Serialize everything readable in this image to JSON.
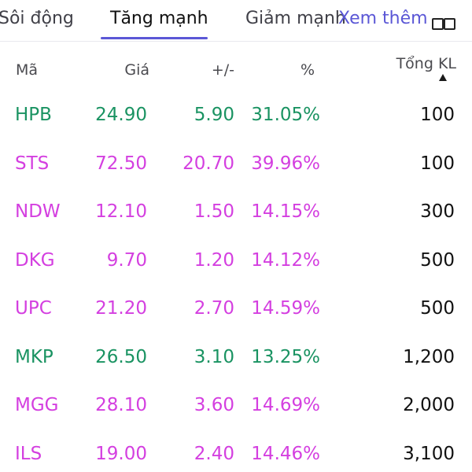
{
  "tabs": [
    {
      "label": "Sôi động"
    },
    {
      "label": "Tăng mạnh"
    },
    {
      "label": "Giảm mạnh"
    },
    {
      "label": "Xem thêm"
    }
  ],
  "header": {
    "ticker": "Mã",
    "price": "Giá",
    "change": "+/-",
    "pct": "%",
    "volume": "Tổng KL"
  },
  "colors": {
    "up": "#1a9362",
    "ceiling": "#d43fe0",
    "accent": "#5b57d6"
  },
  "rows": [
    {
      "ticker": "HPB",
      "price": "24.90",
      "change": "5.90",
      "pct": "31.05%",
      "volume": "100",
      "status": "up"
    },
    {
      "ticker": "STS",
      "price": "72.50",
      "change": "20.70",
      "pct": "39.96%",
      "volume": "100",
      "status": "ceiling"
    },
    {
      "ticker": "NDW",
      "price": "12.10",
      "change": "1.50",
      "pct": "14.15%",
      "volume": "300",
      "status": "ceiling"
    },
    {
      "ticker": "DKG",
      "price": "9.70",
      "change": "1.20",
      "pct": "14.12%",
      "volume": "500",
      "status": "ceiling"
    },
    {
      "ticker": "UPC",
      "price": "21.20",
      "change": "2.70",
      "pct": "14.59%",
      "volume": "500",
      "status": "ceiling"
    },
    {
      "ticker": "MKP",
      "price": "26.50",
      "change": "3.10",
      "pct": "13.25%",
      "volume": "1,200",
      "status": "up"
    },
    {
      "ticker": "MGG",
      "price": "28.10",
      "change": "3.60",
      "pct": "14.69%",
      "volume": "2,000",
      "status": "ceiling"
    },
    {
      "ticker": "ILS",
      "price": "19.00",
      "change": "2.40",
      "pct": "14.46%",
      "volume": "3,100",
      "status": "ceiling"
    }
  ]
}
